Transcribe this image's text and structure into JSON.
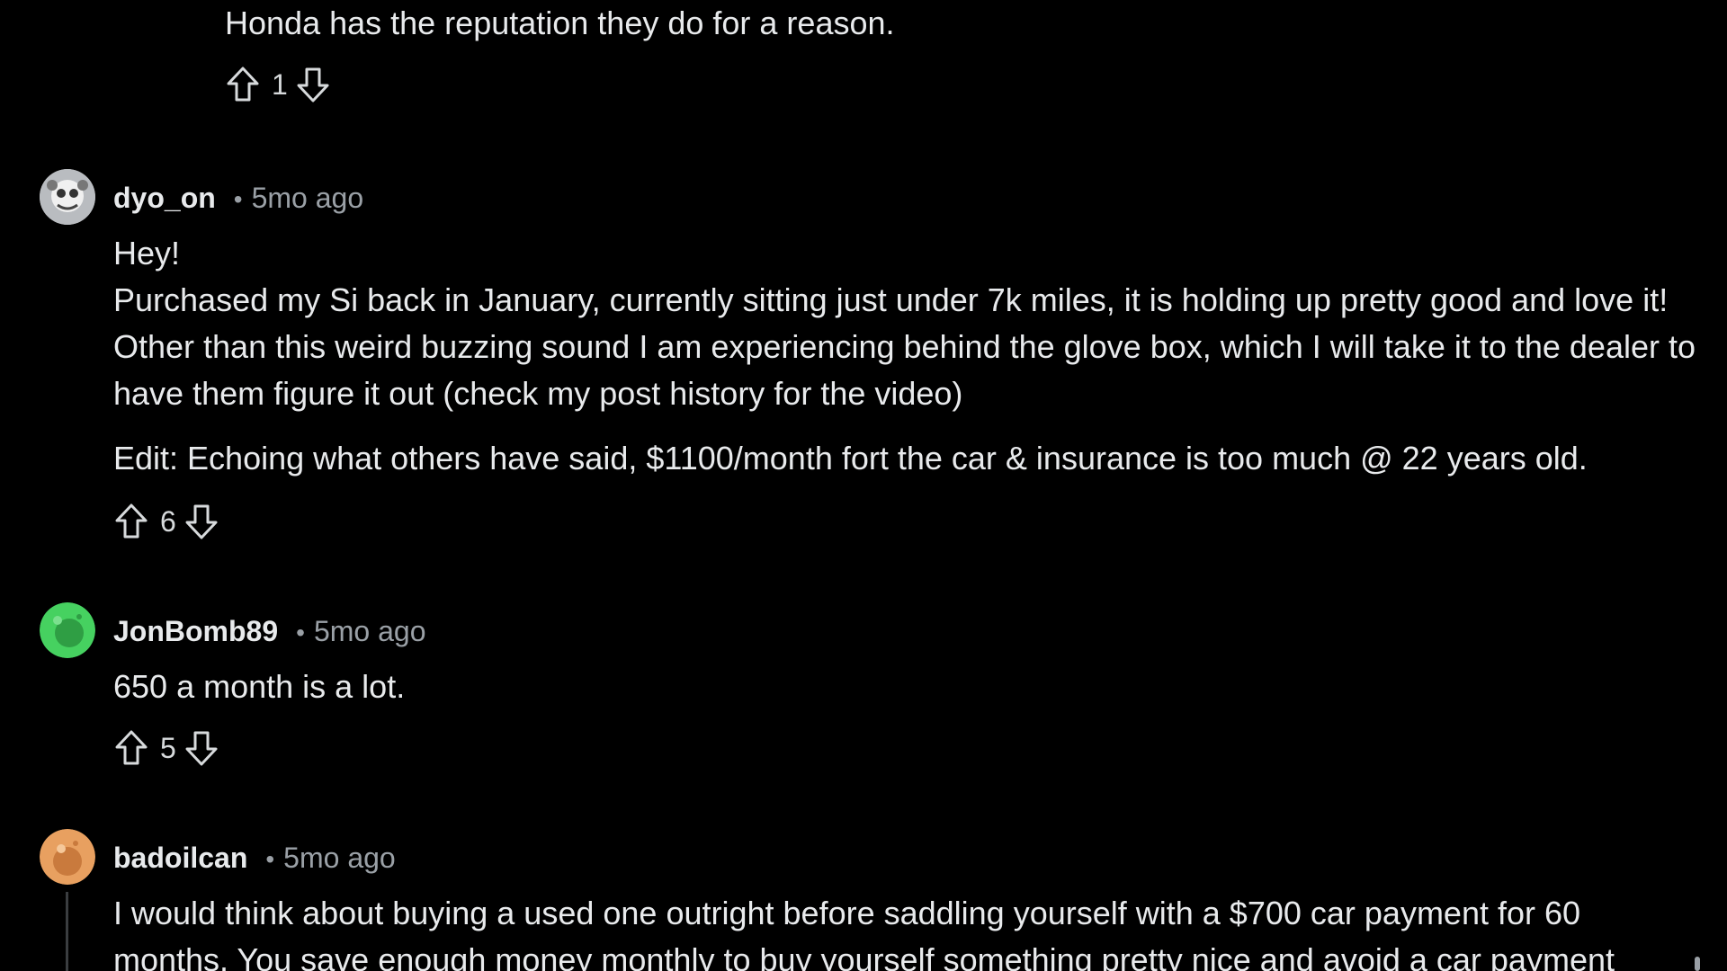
{
  "comments": [
    {
      "body": [
        "Honda has the reputation they do for a reason."
      ],
      "score": "1"
    },
    {
      "username": "dyo_on",
      "separator": "•",
      "time": "5mo ago",
      "body": [
        "Hey!",
        "Purchased my Si back in January, currently sitting just under 7k miles, it is holding up pretty good and love it! Other than this weird buzzing sound I am experiencing behind the glove box, which I will take it to the dealer to have them figure it out (check my post history for the video)",
        "Edit: Echoing what others have said, $1100/month fort the car & insurance is too much @ 22 years old."
      ],
      "score": "6",
      "avatar_color": "#8a8f94"
    },
    {
      "username": "JonBomb89",
      "separator": "•",
      "time": "5mo ago",
      "body": [
        "650 a month is a lot."
      ],
      "score": "5",
      "avatar_color": "#46d160"
    },
    {
      "username": "badoilcan",
      "separator": "•",
      "time": "5mo ago",
      "body": [
        "I would think about buying a used one outright before saddling yourself with a $700 car payment for 60 months. You save enough money monthly to buy yourself something pretty nice and avoid a car payment"
      ],
      "avatar_color": "#e8a060"
    }
  ],
  "icons": {
    "upvote": "upvote-icon",
    "downvote": "downvote-icon"
  }
}
